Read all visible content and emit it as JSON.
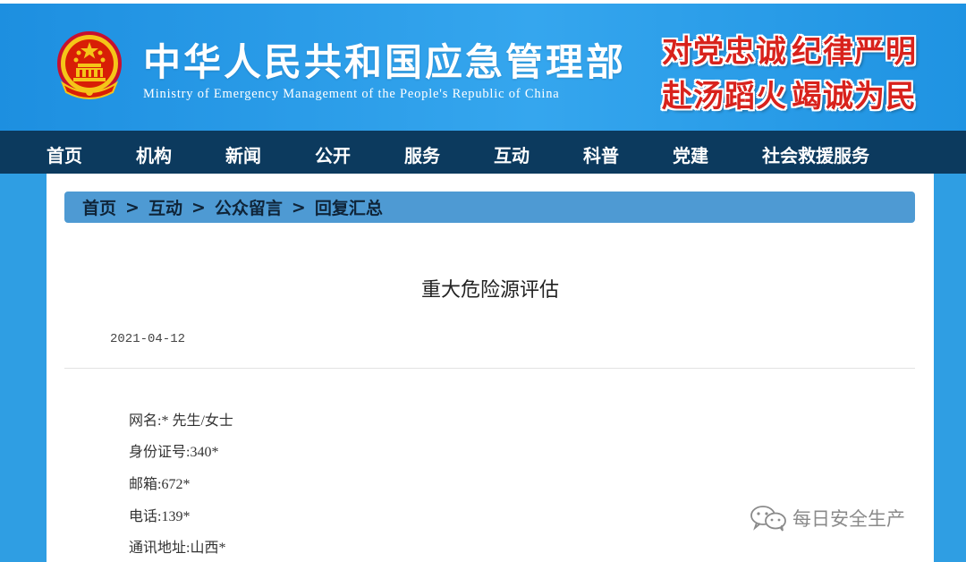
{
  "header": {
    "title_cn": "中华人民共和国应急管理部",
    "title_en": "Ministry of Emergency Management of the People's Republic of China",
    "slogans": [
      "对党忠诚",
      "纪律严明",
      "赴汤蹈火",
      "竭诚为民"
    ],
    "colors": {
      "header_blue": "#2f9ee3",
      "slogan_red": "#d8221c",
      "emblem_gold": "#f5c518"
    }
  },
  "nav": {
    "items": [
      "首页",
      "机构",
      "新闻",
      "公开",
      "服务",
      "互动",
      "科普",
      "党建",
      "社会救援服务"
    ]
  },
  "breadcrumb": {
    "items": [
      "首页",
      "互动",
      "公众留言",
      "回复汇总"
    ],
    "separator": ">"
  },
  "article": {
    "title": "重大危险源评估",
    "date": "2021-04-12",
    "fields": [
      "网名:* 先生/女士",
      "身份证号:340*",
      "邮箱:672*",
      "电话:139*",
      "通讯地址:山西*"
    ]
  },
  "watermark": {
    "text": "每日安全生产",
    "icon": "wechat-icon"
  }
}
